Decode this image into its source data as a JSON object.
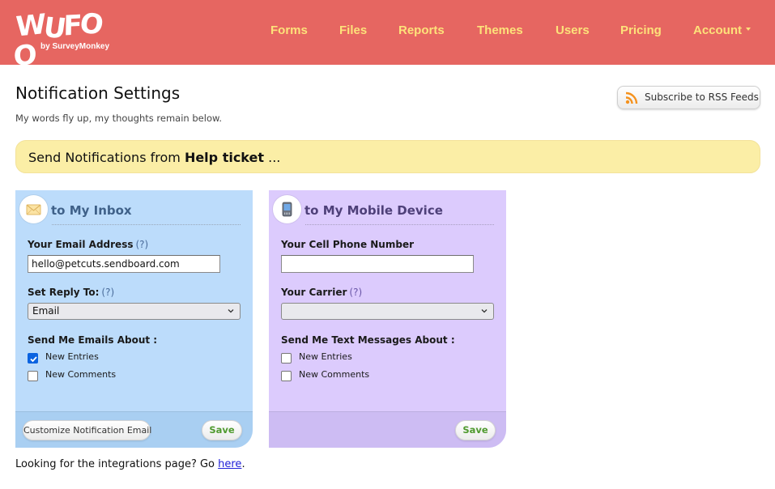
{
  "brand": {
    "logo_text": "WUFOO",
    "logo_letters": [
      "W",
      "U",
      "F",
      "O",
      "O"
    ],
    "byline": "by SurveyMonkey",
    "header_color": "#e66661",
    "nav_color": "#fde27a"
  },
  "nav": {
    "items": [
      {
        "label": "Forms"
      },
      {
        "label": "Files"
      },
      {
        "label": "Reports"
      },
      {
        "label": "Themes"
      },
      {
        "label": "Users"
      },
      {
        "label": "Pricing"
      },
      {
        "label": "Account",
        "icon": "caret-down-icon"
      }
    ]
  },
  "page": {
    "title": "Notification Settings",
    "subtitle": "My words fly up, my thoughts remain below.",
    "rss_button": {
      "label": "Subscribe to RSS Feeds",
      "icon": "rss-icon"
    }
  },
  "banner": {
    "prefix": "Send Notifications from ",
    "form_name": "Help ticket",
    "suffix": " ..."
  },
  "inbox_panel": {
    "icon": "envelope-icon",
    "heading": "to My Inbox",
    "email_label": "Your Email Address",
    "email_help": "(?)",
    "email_value": "hello@petcuts.sendboard.com",
    "reply_label": "Set Reply To:",
    "reply_help": "(?)",
    "reply_selected": "Email",
    "about_label": "Send Me Emails About :",
    "options": [
      {
        "label": "New Entries",
        "checked": true
      },
      {
        "label": "New Comments",
        "checked": false
      }
    ],
    "customize_button": "Customize Notification Email",
    "save_button": "Save",
    "color": "#bcdcfb"
  },
  "mobile_panel": {
    "icon": "mobile-phone-icon",
    "heading": "to My Mobile Device",
    "phone_label": "Your Cell Phone Number",
    "phone_value": "",
    "carrier_label": "Your Carrier",
    "carrier_help": "(?)",
    "carrier_selected": "",
    "about_label": "Send Me Text Messages About :",
    "options": [
      {
        "label": "New Entries",
        "checked": false
      },
      {
        "label": "New Comments",
        "checked": false
      }
    ],
    "save_button": "Save",
    "color": "#dccbfd"
  },
  "footer": {
    "text": "Looking for the integrations page? Go ",
    "link_label": "here",
    "suffix": "."
  }
}
